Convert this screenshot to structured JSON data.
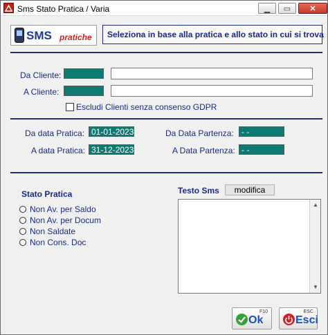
{
  "window": {
    "title": "Sms Stato Pratica / Varia",
    "minimize": "▁",
    "maximize": "▭",
    "close": "✕"
  },
  "logo": {
    "sms": "SMS",
    "pratiche": "pratiche"
  },
  "header": {
    "text": "Seleziona in base alla pratica e allo stato in cui si trova"
  },
  "cliente": {
    "da_label": "Da Cliente:",
    "a_label": "A Cliente:",
    "gdpr_label": "Escludi Clienti senza consenso GDPR"
  },
  "dates": {
    "da_pratica_label": "Da data Pratica:",
    "da_pratica_value": "01-01-2023",
    "a_pratica_label": "A data Pratica:",
    "a_pratica_value": "31-12-2023",
    "da_partenza_label": "Da Data Partenza:",
    "da_partenza_value": "- -",
    "a_partenza_label": "A Data Partenza:",
    "a_partenza_value": "- -"
  },
  "stato": {
    "title": "Stato Pratica",
    "options": [
      "Non Av. per Saldo",
      "Non Av. per Docum",
      "Non Saldate",
      "Non Cons. Doc"
    ]
  },
  "sms": {
    "title": "Testo Sms",
    "modifica": "modifica"
  },
  "buttons": {
    "ok_label": "Ok",
    "ok_key": "F10",
    "esci_label": "Esci",
    "esci_key": "ESC"
  },
  "colors": {
    "accent": "#1a2a8a",
    "field": "#0f7a72"
  }
}
